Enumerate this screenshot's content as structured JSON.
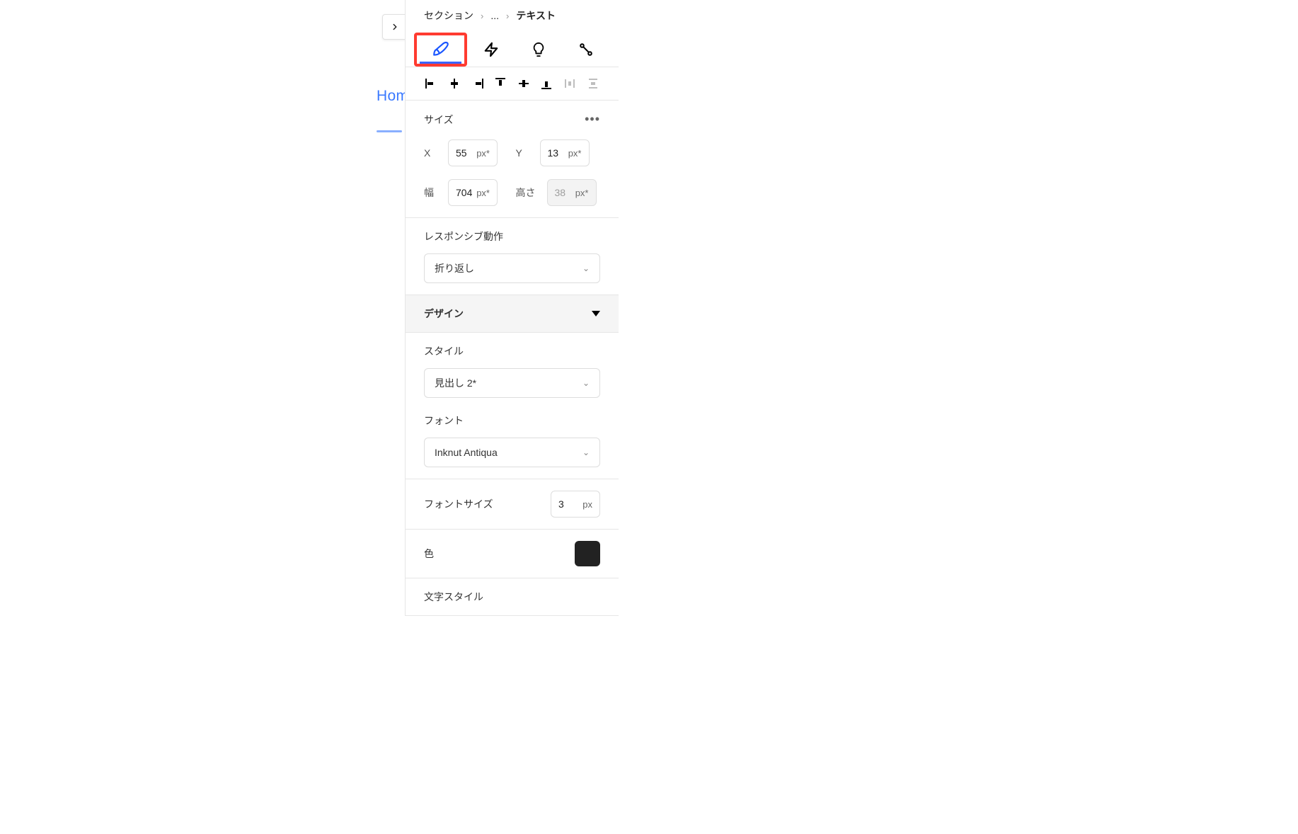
{
  "breadcrumb": {
    "root": "セクション",
    "ellipsis": "...",
    "current": "テキスト"
  },
  "canvas": {
    "home_text": "Hom"
  },
  "sections": {
    "size": {
      "title": "サイズ",
      "x_label": "X",
      "x_value": "55",
      "x_unit": "px*",
      "y_label": "Y",
      "y_value": "13",
      "y_unit": "px*",
      "width_label": "幅",
      "width_value": "704",
      "width_unit": "px*",
      "height_label": "高さ",
      "height_value": "38",
      "height_unit": "px*"
    },
    "responsive": {
      "title": "レスポンシブ動作",
      "value": "折り返し"
    },
    "design": {
      "title": "デザイン"
    },
    "style": {
      "title": "スタイル",
      "value": "見出し 2*"
    },
    "font": {
      "title": "フォント",
      "value": "Inknut Antiqua"
    },
    "font_size": {
      "title": "フォントサイズ",
      "value": "3",
      "unit": "px"
    },
    "color": {
      "title": "色",
      "value": "#222222"
    },
    "text_style": {
      "title": "文字スタイル"
    }
  }
}
